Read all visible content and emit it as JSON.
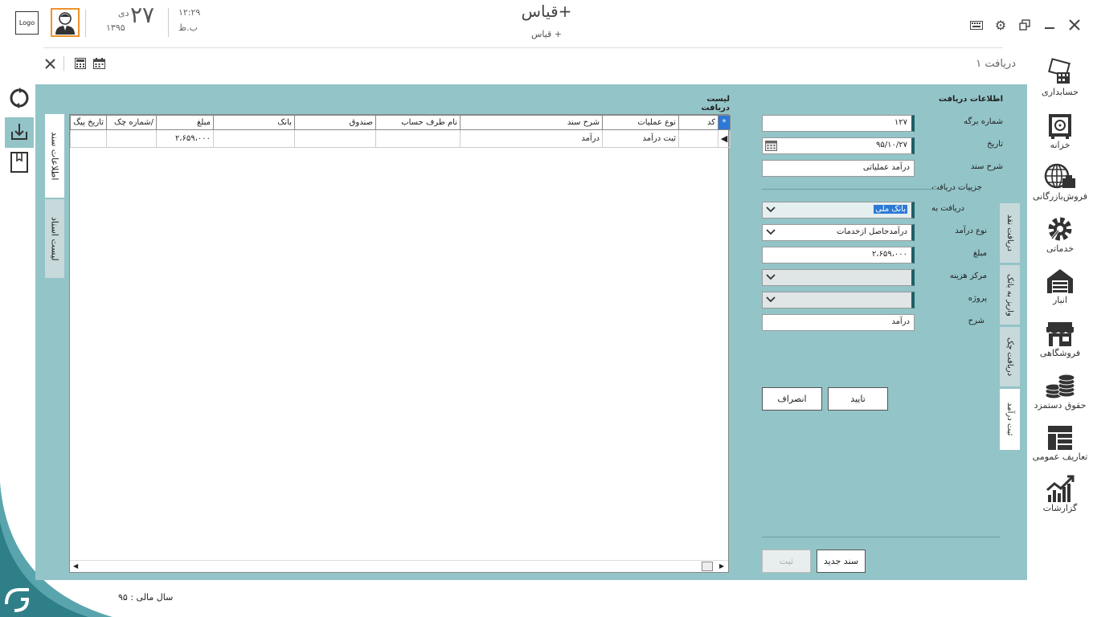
{
  "header": {
    "logo": "Logo",
    "day": "۲۷",
    "month": "دی",
    "year": "۱۳۹۵",
    "time": "۱۲:۲۹",
    "ampm": "ب.ظ",
    "app_title": "قیاس+",
    "app_subtitle": "قیاس +"
  },
  "tab": {
    "title": "دریافت ۱"
  },
  "nav": [
    {
      "label": "حسابداری",
      "icon": "accounting-icon"
    },
    {
      "label": "خزانه",
      "icon": "safe-icon"
    },
    {
      "label": "فروش‌بازرگانی",
      "icon": "globe-trade-icon"
    },
    {
      "label": "خدماتی",
      "icon": "service-gear-icon"
    },
    {
      "label": "انبار",
      "icon": "warehouse-icon"
    },
    {
      "label": "فروشگاهی",
      "icon": "store-icon"
    },
    {
      "label": "حقوق دستمزد",
      "icon": "coins-icon"
    },
    {
      "label": "تعاریف عمومی",
      "icon": "layout-icon"
    },
    {
      "label": "گزارشات",
      "icon": "chart-icon"
    }
  ],
  "left_tabs": {
    "doc_info": "اطلاعات سند",
    "doc_list": "لیست اسناد"
  },
  "list": {
    "title": "لیست دریافت",
    "columns": [
      "کد",
      "نوع عملیات",
      "شرح سند",
      "نام طرف حساب",
      "صندوق",
      "بانک",
      "مبلغ",
      "شماره چک/",
      "تاریخ پیگ"
    ],
    "rows": [
      [
        "",
        "ثبت درآمد",
        "درآمد",
        "",
        "",
        "",
        "۲،۶۵۹،۰۰۰",
        "",
        ""
      ]
    ],
    "new_row_marker": "*"
  },
  "form": {
    "title": "اطلاعات دریافت",
    "sheet_no_label": "شماره برگه",
    "sheet_no": "۱۲۷",
    "date_label": "تاریخ",
    "date": "۹۵/۱۰/۲۷",
    "desc_label": "شرح سند",
    "desc": "درآمد عملیاتی",
    "details_title": "جزییات دریافت",
    "receive_to_label": "دریافت به",
    "receive_to": "بانک ملی",
    "income_type_label": "نوع درآمد",
    "income_type": "درآمدحاصل ازخدمات",
    "amount_label": "مبلغ",
    "amount": "۲،۶۵۹،۰۰۰",
    "cost_center_label": "مرکز هزینه",
    "cost_center": "",
    "project_label": "پروژه",
    "project": "",
    "note_label": "شرح",
    "note": "درآمد",
    "confirm": "تایید",
    "cancel": "انصراف",
    "new_doc": "سند جدید",
    "save": "ثبت"
  },
  "right_tabs": [
    "دریافت نقد",
    "واریز به بانک",
    "دریافت چک",
    "ثبت درآمد"
  ],
  "footer": {
    "fiscal_year": "سال مالی : ۹۵"
  }
}
